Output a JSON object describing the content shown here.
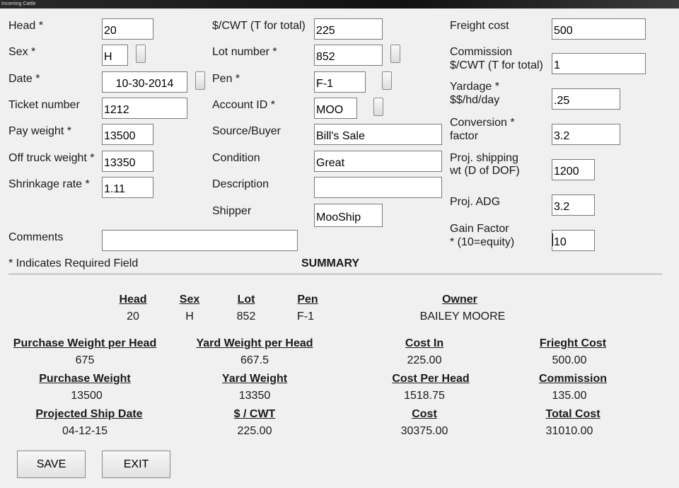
{
  "window": {
    "title": "Incoming Cattle"
  },
  "form": {
    "head": {
      "label": "Head *",
      "value": "20"
    },
    "sex": {
      "label": "Sex *",
      "value": "H"
    },
    "date": {
      "label": "Date *",
      "value": "10-30-2014"
    },
    "ticket_number": {
      "label": "Ticket number",
      "value": "1212"
    },
    "pay_weight": {
      "label": "Pay weight *",
      "value": "13500"
    },
    "off_truck_weight": {
      "label": "Off truck weight *",
      "value": "13350"
    },
    "shrinkage_rate": {
      "label": "Shrinkage rate *",
      "value": "1.11"
    },
    "cwt": {
      "label": "$/CWT (T for total)",
      "value": "225"
    },
    "lot_number": {
      "label": "Lot number *",
      "value": "852"
    },
    "pen": {
      "label": "Pen *",
      "value": "F-1"
    },
    "account_id": {
      "label": "Account ID *",
      "value": "MOO"
    },
    "source_buyer": {
      "label": "Source/Buyer",
      "value": "Bill's Sale"
    },
    "condition": {
      "label": "Condition",
      "value": "Great"
    },
    "description": {
      "label": "Description",
      "value": ""
    },
    "shipper": {
      "label": "Shipper",
      "value": "MooShip"
    },
    "freight_cost": {
      "label": "Freight cost",
      "value": "500"
    },
    "commission": {
      "label_line1": "Commission",
      "label_line2": "$/CWT (T for total)",
      "value": "1"
    },
    "yardage": {
      "label_line1": "Yardage *",
      "label_line2": "$$/hd/day",
      "value": ".25"
    },
    "conversion_factor": {
      "label_line1": "Conversion *",
      "label_line2": "factor",
      "value": "3.2"
    },
    "proj_shipping_wt": {
      "label_line1": "Proj. shipping",
      "label_line2": "wt (D of DOF)",
      "value": "1200"
    },
    "proj_adg": {
      "label": "Proj.  ADG",
      "value": "3.2"
    },
    "gain_factor": {
      "label_line1": "Gain Factor",
      "label_line2": "* (10=equity)",
      "value": "10"
    },
    "comments": {
      "label": "Comments",
      "value": ""
    },
    "required_note": "* Indicates Required Field"
  },
  "summary": {
    "title": "SUMMARY",
    "head": {
      "label": "Head",
      "value": "20"
    },
    "sex": {
      "label": "Sex",
      "value": "H"
    },
    "lot": {
      "label": "Lot",
      "value": "852"
    },
    "pen": {
      "label": "Pen",
      "value": "F-1"
    },
    "owner": {
      "label": "Owner",
      "value": "BAILEY MOORE"
    },
    "purchase_weight_per_head": {
      "label": "Purchase Weight per Head",
      "value": "675"
    },
    "yard_weight_per_head": {
      "label": "Yard Weight per Head",
      "value": "667.5"
    },
    "cost_in": {
      "label": "Cost In",
      "value": "225.00"
    },
    "freight_cost": {
      "label": "Frieght Cost",
      "value": "500.00"
    },
    "purchase_weight": {
      "label": "Purchase Weight",
      "value": "13500"
    },
    "yard_weight": {
      "label": "Yard Weight",
      "value": "13350"
    },
    "cost_per_head": {
      "label": "Cost Per Head",
      "value": "1518.75"
    },
    "commission": {
      "label": "Commission",
      "value": "135.00"
    },
    "projected_ship_date": {
      "label": "Projected Ship Date",
      "value": "04-12-15"
    },
    "cwt": {
      "label": "$ / CWT",
      "value": "225.00"
    },
    "cost": {
      "label": "Cost",
      "value": "30375.00"
    },
    "total_cost": {
      "label": "Total Cost",
      "value": "31010.00"
    }
  },
  "buttons": {
    "save": "SAVE",
    "exit": "EXIT"
  }
}
